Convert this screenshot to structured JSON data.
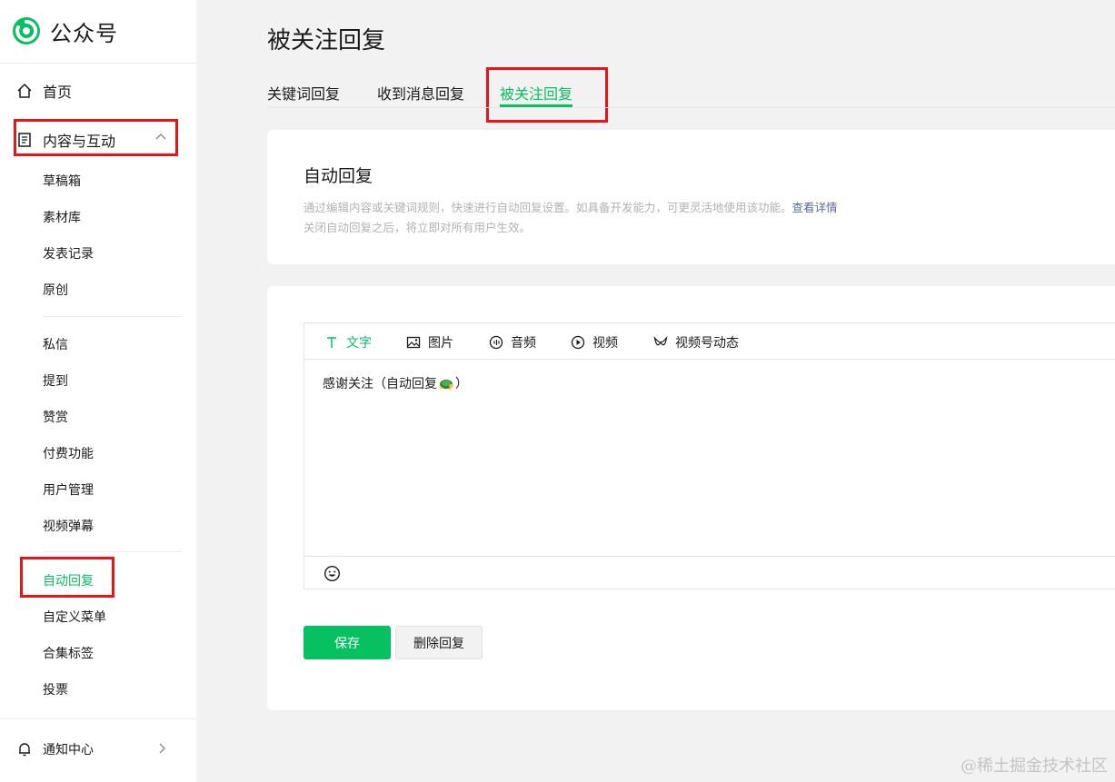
{
  "brand": {
    "name": "公众号",
    "color": "#07c160"
  },
  "sidebar": {
    "home": {
      "label": "首页",
      "icon": "home-icon"
    },
    "content_group": {
      "label": "内容与互动",
      "icon": "document-icon",
      "expanded": true
    },
    "group1": [
      "草稿箱",
      "素材库",
      "发表记录",
      "原创"
    ],
    "group2": [
      "私信",
      "提到",
      "赞赏",
      "付费功能",
      "用户管理",
      "视频弹幕"
    ],
    "group3": [
      "自动回复",
      "自定义菜单",
      "合集标签",
      "投票"
    ],
    "active_item": "自动回复",
    "notice": {
      "label": "通知中心",
      "icon": "bell-icon"
    }
  },
  "page": {
    "title": "被关注回复",
    "tabs": [
      "关键词回复",
      "收到消息回复",
      "被关注回复"
    ],
    "active_tab": "被关注回复"
  },
  "auto_reply": {
    "title": "自动回复",
    "desc_line1": "通过编辑内容或关键词规则，快速进行自动回复设置。如具备开发能力，可更灵活地使用该功能。",
    "desc_link": "查看详情",
    "desc_line2": "关闭自动回复之后，将立即对所有用户生效。"
  },
  "editor": {
    "tabs": [
      {
        "label": "文字",
        "icon": "text-icon"
      },
      {
        "label": "图片",
        "icon": "image-icon"
      },
      {
        "label": "音频",
        "icon": "audio-icon"
      },
      {
        "label": "视频",
        "icon": "video-play-icon"
      },
      {
        "label": "视频号动态",
        "icon": "channels-icon"
      }
    ],
    "active_tab": "文字",
    "content_before": "感谢关注（自动回复",
    "content_after": "）",
    "content_emoji": "turtle-emoji",
    "footer_icon": "smile-icon"
  },
  "buttons": {
    "save": "保存",
    "delete": "删除回复"
  },
  "watermark": "@稀土掘金技术社区",
  "colors": {
    "accent": "#07c160",
    "highlight_box": "#e8141b",
    "link": "#576b95"
  }
}
